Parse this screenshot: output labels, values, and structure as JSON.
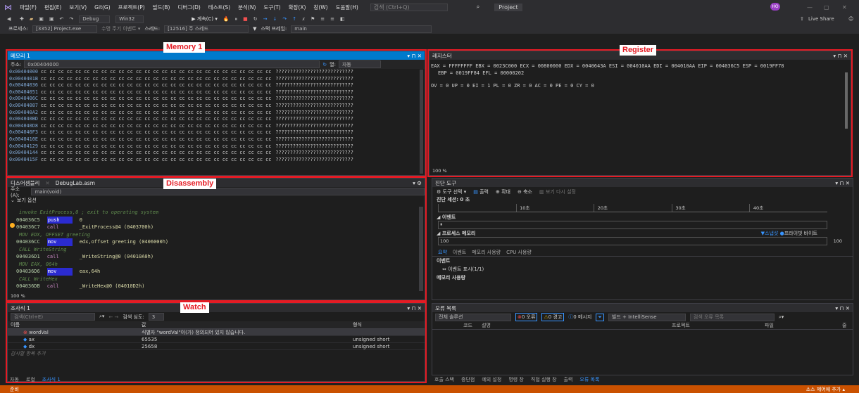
{
  "menu": {
    "logo": "⋈",
    "items": [
      "파일(F)",
      "편집(E)",
      "보기(V)",
      "Git(G)",
      "프로젝트(P)",
      "빌드(B)",
      "디버그(D)",
      "테스트(S)",
      "분석(N)",
      "도구(T)",
      "확장(X)",
      "창(W)",
      "도움말(H)"
    ],
    "search_placeholder": "검색 (Ctrl+Q)",
    "project": "Project",
    "avatar": "HO",
    "live_share": "Live Share"
  },
  "toolbar": {
    "config": "Debug",
    "platform": "Win32",
    "continue": "▶ 계속(C) ▾"
  },
  "toolbar2": {
    "process_label": "프로세스:",
    "process": "[3352] Project.exe",
    "event_label": "수명 주기 이벤트 ▾",
    "thread_label": "스레드:",
    "thread": "[12516] 주 스레드",
    "stack_label": "스택 프레임:",
    "stack": "main"
  },
  "callouts": {
    "memory": "Memory 1",
    "register": "Register",
    "disassembly": "Disassembly",
    "watch": "Watch"
  },
  "memory": {
    "title": "메모리 1",
    "address_label": "주소:",
    "address": "0x00404000",
    "col_label": "열:",
    "col": "자동",
    "bytes": "cc cc cc cc cc cc cc cc cc cc cc cc cc cc cc cc cc cc cc cc cc cc cc cc cc cc cc",
    "chars": "???????????????????????????",
    "rows": [
      "0x00404000",
      "0x0040401B",
      "0x00404036",
      "0x00404051",
      "0x0040406C",
      "0x00404087",
      "0x004040A2",
      "0x004040BD",
      "0x004040D8",
      "0x004040F3",
      "0x0040410E",
      "0x00404129",
      "0x00404144",
      "0x0040415F"
    ]
  },
  "register": {
    "title": "레지스터",
    "line1": "EAX = FFFFFFFF EBX = 0023C000 ECX = 00800000 EDX = 0040643A ESI = 004010AA EDI = 004010AA EIP = 004036C5 ESP = 0019FF78",
    "line2": "EBP = 0019FF84 EFL = 00000202",
    "line3": "OV = 0 UP = 0 EI = 1 PL = 0 ZR = 0 AC = 0 PE = 0 CY = 0",
    "zoom": "100 %"
  },
  "disasm": {
    "title": "디스어셈블리",
    "tab2": "DebugLab.asm",
    "address_label": "주소(A):",
    "address": "main(void)",
    "options": "보기 옵션",
    "zoom": "100 %",
    "lines": [
      {
        "kind": "comment",
        "text": "invoke ExitProcess,0  ; exit to operating system"
      },
      {
        "kind": "code",
        "addr": "004036C5",
        "op": "push",
        "arg": "0"
      },
      {
        "kind": "code",
        "addr": "004036C7",
        "op": "call",
        "arg": "_ExitProcess@4 (0403700h)"
      },
      {
        "kind": "comment",
        "text": "MOV   EDX, OFFSET greeting"
      },
      {
        "kind": "code",
        "addr": "004036CC",
        "op": "mov",
        "arg": "edx,offset greeting (0406000h)"
      },
      {
        "kind": "comment",
        "text": "CALL  WriteString"
      },
      {
        "kind": "code",
        "addr": "004036D1",
        "op": "call",
        "arg": "_WriteString@0 (04010A0h)"
      },
      {
        "kind": "comment",
        "text": "MOV   EAX, 064h"
      },
      {
        "kind": "code",
        "addr": "004036D6",
        "op": "mov",
        "arg": "eax,64h"
      },
      {
        "kind": "comment",
        "text": "CALL  WriteHex"
      },
      {
        "kind": "code",
        "addr": "004036DB",
        "op": "call",
        "arg": "_WriteHex@0 (04010D2h)"
      }
    ]
  },
  "watch": {
    "title": "조사식 1",
    "search_placeholder": "검색(Ctrl+E)",
    "depth_label": "검색 심도:",
    "depth": "3",
    "cols": [
      "이름",
      "값",
      "형식"
    ],
    "rows": [
      {
        "name": "wordVal",
        "value": "식별자 \"wordVal\"이(가) 정의되어 있지 않습니다.",
        "type": ""
      },
      {
        "name": "ax",
        "value": "65535",
        "type": "unsigned short"
      },
      {
        "name": "dx",
        "value": "25658",
        "type": "unsigned short"
      }
    ],
    "add_hint": "감시할 항목 추가",
    "bottom_tabs": [
      "자동",
      "로컬",
      "조사식 1"
    ]
  },
  "diag": {
    "title": "진단 도구",
    "tools": "도구 선택 ▾",
    "output": "출력",
    "zoom_in": "확대",
    "zoom_out": "축소",
    "reset": "보기 다시 설정",
    "session": "진단 세션: 0 초",
    "ticks": [
      "10초",
      "20초",
      "30초",
      "40초"
    ],
    "events": "이벤트",
    "process_mem": "프로세스 메모리",
    "snapshot": "▼스냅샷",
    "private_bytes": "프라이빗 바이트",
    "mem_left": "100",
    "mem_right": "100",
    "tabs": [
      "요약",
      "이벤트",
      "메모리 사용량",
      "CPU 사용량"
    ],
    "sec_events": "이벤트",
    "show_events": "이벤트 표시(1/1)",
    "sec_mem": "메모리 사용량"
  },
  "errors": {
    "title": "오류 목록",
    "scope": "전체 솔루션",
    "err": "0 오류",
    "warn": "0 경고",
    "msg": "0 메시지",
    "build": "빌드 + IntelliSense",
    "search": "검색 오류 목록",
    "cols": [
      "코드",
      "설명",
      "프로젝트",
      "파일",
      "줄"
    ],
    "bottom_tabs": [
      "호출 스택",
      "중단점",
      "예외 설정",
      "명령 창",
      "직접 실행 창",
      "출력",
      "오류 목록"
    ]
  },
  "status": {
    "left": "준비",
    "right": "소스 제어에 추가 ▴"
  },
  "colors": {
    "accent": "#007acc",
    "callout": "#e51b24"
  }
}
